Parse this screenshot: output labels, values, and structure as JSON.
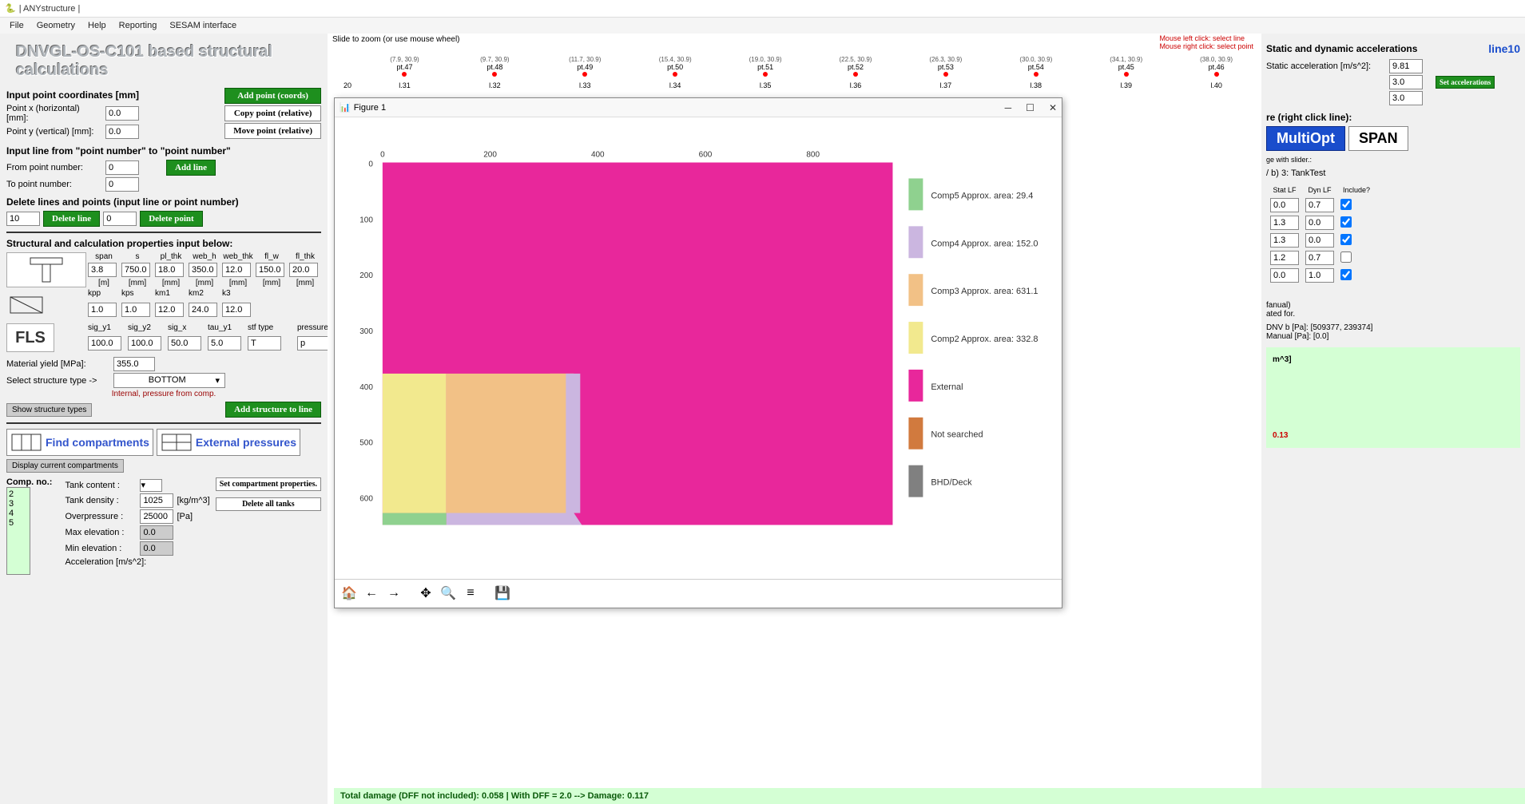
{
  "title": "| ANYstructure |",
  "menu": {
    "file": "File",
    "geometry": "Geometry",
    "help": "Help",
    "reporting": "Reporting",
    "sesam": "SESAM interface"
  },
  "main_title": "DNVGL-OS-C101 based structural calculations",
  "left": {
    "coord_title": "Input point coordinates [mm]",
    "pt_x_lbl": "Point x (horizontal) [mm]:",
    "pt_y_lbl": "Point y (vertical)   [mm]:",
    "pt_x": "0.0",
    "pt_y": "0.0",
    "add_point": "Add point (coords)",
    "copy_point": "Copy point (relative)",
    "move_point": "Move point (relative)",
    "line_title": "Input line from \"point number\" to \"point number\"",
    "from_lbl": "From point number:",
    "to_lbl": "To point number:",
    "from_v": "0",
    "to_v": "0",
    "add_line": "Add line",
    "delete_title": "Delete lines and points (input line or point number)",
    "del_line_v": "10",
    "del_line": "Delete line",
    "del_pt_v": "0",
    "del_pt": "Delete point",
    "struct_title": "Structural and calculation properties input below:",
    "h_span": "span",
    "h_s": "s",
    "h_pl": "pl_thk",
    "h_wh": "web_h",
    "h_wt": "web_thk",
    "h_flw": "fl_w",
    "h_flt": "fl_thk",
    "v_span": "3.8",
    "v_s": "750.0",
    "v_pl": "18.0",
    "v_wh": "350.0",
    "v_wt": "12.0",
    "v_flw": "150.0",
    "v_flt": "20.0",
    "u_m": "[m]",
    "u_mm": "[mm]",
    "h_kpp": "kpp",
    "h_kps": "kps",
    "h_km1": "km1",
    "h_km2": "km2",
    "h_k3": "k3",
    "v_kpp": "1.0",
    "v_kps": "1.0",
    "v_km1": "12.0",
    "v_km2": "24.0",
    "v_k3": "12.0",
    "h_sy1": "sig_y1",
    "h_sy2": "sig_y2",
    "h_sx": "sig_x",
    "h_tau": "tau_y1",
    "h_stf": "stf type",
    "h_ps": "pressure side",
    "v_sy1": "100.0",
    "v_sy2": "100.0",
    "v_sx": "50.0",
    "v_tau": "5.0",
    "v_stf": "T",
    "v_ps": "p",
    "fls": "FLS",
    "yield_lbl": "Material yield [MPa]:",
    "yield_v": "355.0",
    "stype_lbl": "Select structure type ->",
    "stype_v": "BOTTOM",
    "internal_note": "Internal, pressure from comp.",
    "show_types": "Show structure types",
    "add_struct": "Add structure to line",
    "find_comp": "Find compartments",
    "ext_press": "External pressures",
    "disp_comp": "Display current compartments",
    "comp_no_lbl": "Comp. no.:",
    "comp_list": [
      "2",
      "3",
      "4",
      "5"
    ],
    "tank_content_lbl": "Tank content :",
    "tank_density_lbl": "Tank density :",
    "tank_density_v": "1025",
    "tank_density_u": "[kg/m^3]",
    "overp_lbl": "Overpressure :",
    "overp_v": "25000",
    "overp_u": "[Pa]",
    "maxel_lbl": "Max elevation :",
    "maxel_v": "0.0",
    "minel_lbl": "Min elevation :",
    "minel_v": "0.0",
    "accel_lbl": "Acceleration [m/s^2]:",
    "set_comp_props": "Set compartment properties.",
    "del_tanks": "Delete all tanks"
  },
  "middle": {
    "zoom_hint": "Slide to zoom (or use mouse wheel)",
    "mouse1": "Mouse left click:   select line",
    "mouse2": "Mouse right click: select point",
    "ruler": [
      {
        "coord": "(7.9, 30.9)",
        "pt": "pt.47"
      },
      {
        "coord": "(9.7, 30.9)",
        "pt": "pt.48"
      },
      {
        "coord": "(11.7, 30.9)",
        "pt": "pt.49"
      },
      {
        "coord": "(15.4, 30.9)",
        "pt": "pt.50"
      },
      {
        "coord": "(19.0, 30.9)",
        "pt": "pt.51"
      },
      {
        "coord": "(22.5, 30.9)",
        "pt": "pt.52"
      },
      {
        "coord": "(26.3, 30.9)",
        "pt": "pt.53"
      },
      {
        "coord": "(30.0, 30.9)",
        "pt": "pt.54"
      },
      {
        "coord": "(34.1, 30.9)",
        "pt": "pt.45"
      },
      {
        "coord": "(38.0, 30.9)",
        "pt": "pt.46"
      }
    ],
    "lines": [
      "l.31",
      "l.32",
      "l.33",
      "l.34",
      "l.35",
      "l.36",
      "l.37",
      "l.38",
      "l.39",
      "l.40"
    ],
    "y20": "20",
    "figure_title": "Figure 1"
  },
  "chart_data": {
    "type": "heatmap",
    "title": "",
    "xlabel": "",
    "ylabel": "",
    "xlim": [
      0,
      900
    ],
    "ylim": [
      0,
      650
    ],
    "x_ticks": [
      0,
      200,
      400,
      600,
      800
    ],
    "y_ticks": [
      0,
      100,
      200,
      300,
      400,
      500,
      600
    ],
    "regions": [
      {
        "label": "External",
        "color": "#e8279b",
        "approx_bbox": [
          0,
          0,
          900,
          650
        ]
      },
      {
        "label": "Comp2",
        "color": "#f2e98e",
        "approx_area": 332.8,
        "approx_bbox": [
          0,
          380,
          110,
          650
        ]
      },
      {
        "label": "Comp3",
        "color": "#f2c186",
        "approx_area": 631.1,
        "approx_bbox": [
          110,
          380,
          330,
          650
        ]
      },
      {
        "label": "Comp4",
        "color": "#cbb6e0",
        "approx_area": 152.0,
        "approx_bbox": [
          330,
          380,
          355,
          650
        ]
      },
      {
        "label": "Comp5",
        "color": "#8fd18f",
        "approx_area": 29.4,
        "approx_bbox": [
          0,
          630,
          110,
          650
        ]
      }
    ],
    "legend": [
      {
        "label": "Comp5 Approx. area: 29.4",
        "color": "#8fd18f"
      },
      {
        "label": "Comp4 Approx. area: 152.0",
        "color": "#cbb6e0"
      },
      {
        "label": "Comp3 Approx. area: 631.1",
        "color": "#f2c186"
      },
      {
        "label": "Comp2 Approx. area: 332.8",
        "color": "#f2e98e"
      },
      {
        "label": "External",
        "color": "#e8279b"
      },
      {
        "label": "Not searched",
        "color": "#d17a3e"
      },
      {
        "label": "BHD/Deck",
        "color": "#808080"
      }
    ]
  },
  "right": {
    "accel_title": "Static and dynamic accelerations",
    "line_name": "line10",
    "stat_lbl": "Static acceleration [m/s^2]:",
    "stat_v": "9.81",
    "dyn1": "3.0",
    "dyn2": "3.0",
    "set_accel": "Set accelerations",
    "rclick": "re (right click line):",
    "multiopt": "MultiOpt",
    "span": "SPAN",
    "slider_lbl": "ge with slider.:",
    "tanktest": "/ b)   3: TankTest",
    "col1": "Stat LF",
    "col2": "Dyn LF",
    "col3": "Include?",
    "r1a": "0.0",
    "r1b": "0.7",
    "r2a": "1.3",
    "r2b": "0.0",
    "r3a": "1.3",
    "r3b": "0.0",
    "r4a": "1.2",
    "r4b": "0.7",
    "r5a": "0.0",
    "r5b": "1.0",
    "info1": "fanual)",
    "info2": "ated for.",
    "info3": "DNV b [Pa]: [509377, 239374]",
    "info4": "Manual [Pa]: [0.0]",
    "info5": "m^3]",
    "info6": "0.13"
  },
  "status": "Total damage (DFF not included): 0.058  |  With DFF = 2.0 --> Damage: 0.117"
}
